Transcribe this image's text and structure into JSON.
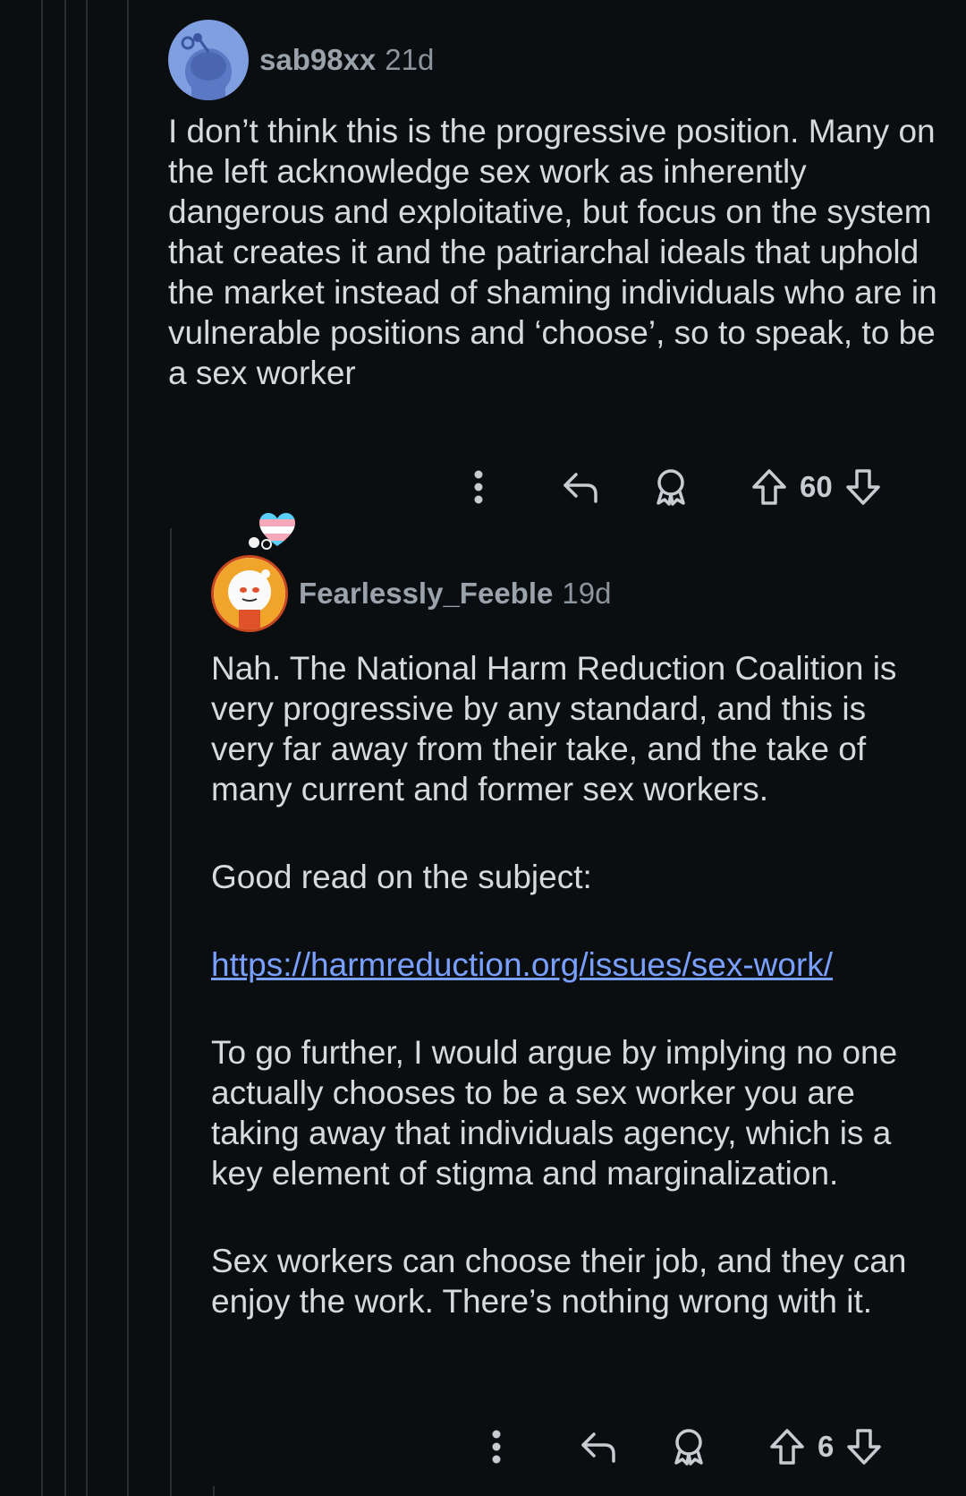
{
  "comments": [
    {
      "username": "sab98xx",
      "age": "21d",
      "paragraphs": [
        "I don’t think this is the progressive position. Many on the left acknowledge sex work as inherently dangerous and exploitative, but focus on the system that creates it and the patriarchal ideals that uphold the market instead of shaming individuals who are in vulnerable positions and ‘choose’, so to speak, to be a sex worker"
      ],
      "votes": "60",
      "avatar_icon": "snoo-avatar-icon"
    },
    {
      "username": "Fearlessly_Feeble",
      "age": "19d",
      "paragraphs": [
        "Nah. The National Harm Reduction Coalition is very progressive by any standard, and this is very far away from their take, and the take of many current and former sex workers.",
        "Good read on the subject:",
        "https://harmreduction.org/issues/sex-work/",
        "To go further, I would argue by implying no one actually chooses to be a sex worker you are taking away that individuals agency, which is a key element of stigma and marginalization.",
        "Sex workers can choose their job, and they can enjoy the work. There’s nothing wrong with it."
      ],
      "votes": "6",
      "avatar_icon": "snoo-avatar-icon"
    }
  ],
  "icons": {
    "more": "more-vertical-icon",
    "reply": "reply-icon",
    "award": "award-icon",
    "upvote": "upvote-icon",
    "downvote": "downvote-icon",
    "flair": "heart-flair-icon"
  },
  "colors": {
    "background": "#0b0e11",
    "text": "#d7dadc",
    "username": "#9aa3ab",
    "link": "#7aa0ff"
  }
}
